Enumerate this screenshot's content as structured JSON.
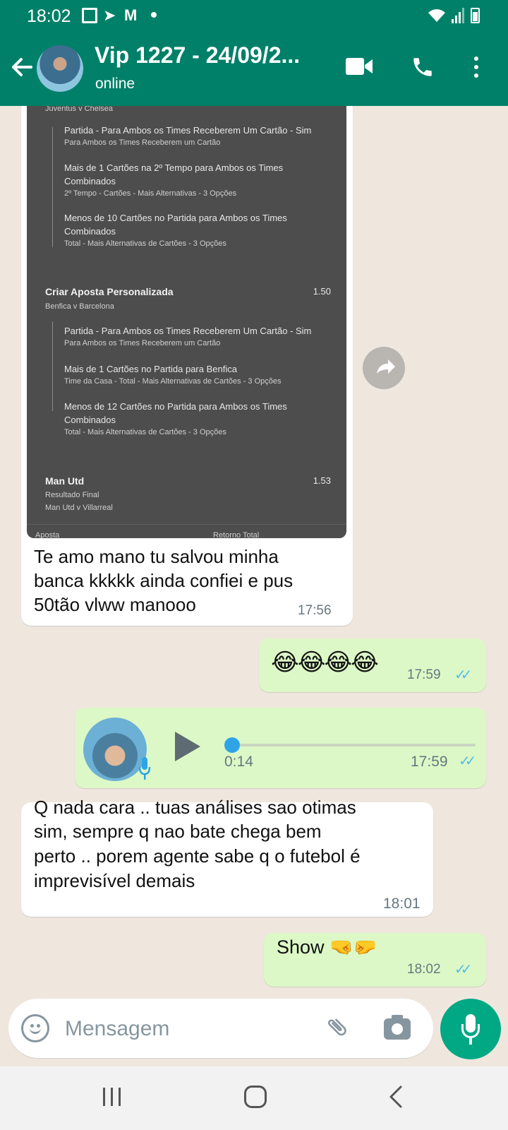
{
  "status_bar": {
    "time": "18:02",
    "icons": [
      "gallery-icon",
      "telegram-icon",
      "gmail-icon",
      "dot-icon",
      "wifi-icon",
      "signal-icon",
      "battery-icon"
    ]
  },
  "header": {
    "contact_name": "Vip 1227 - 24/09/2...",
    "contact_status": "online",
    "icons": [
      "back-arrow-icon",
      "video-call-icon",
      "voice-call-icon",
      "more-options-icon"
    ]
  },
  "colors": {
    "header_bg": "#008069",
    "chat_bg": "#efe7de",
    "incoming_bubble": "#ffffff",
    "outgoing_bubble": "#dcf8c6",
    "read_ticks": "#53bdeb",
    "mic_button": "#00a884"
  },
  "image_message": {
    "partial_top_text": "Juventus v Chelsea",
    "bet1": {
      "legs": [
        {
          "title": "Partida - Para Ambos os Times Receberem Um Cartão - Sim",
          "sub": "Para Ambos os Times Receberem um Cartão"
        },
        {
          "title": "Mais de 1 Cartões na 2º Tempo para Ambos os Times",
          "title2": "Combinados",
          "sub": "2º Tempo - Cartões - Mais Alternativas - 3 Opções"
        },
        {
          "title": "Menos de 10 Cartões no Partida para Ambos os Times",
          "title2": "Combinados",
          "sub": "Total - Mais Alternativas de Cartões - 3 Opções"
        }
      ]
    },
    "bet2": {
      "title": "Criar Aposta Personalizada",
      "odds": "1.50",
      "match": "Benfica v Barcelona",
      "legs": [
        {
          "title": "Partida - Para Ambos os Times Receberem Um Cartão - Sim",
          "sub": "Para Ambos os Times Receberem um Cartão"
        },
        {
          "title": "Mais de 1 Cartões no Partida para Benfica",
          "sub": "Time da Casa - Total - Mais Alternativas de Cartões - 3 Opções"
        },
        {
          "title": "Menos de 12 Cartões no Partida para Ambos os Times",
          "title2": "Combinados",
          "sub": "Total - Mais Alternativas de Cartões - 3 Opções"
        }
      ]
    },
    "bet3": {
      "title": "Man Utd",
      "odds": "1.53",
      "market": "Resultado Final",
      "match": "Man Utd v Villarreal"
    },
    "footer_left": "Aposta",
    "footer_right": "Retorno Total",
    "caption_line1": "Te amo mano tu salvou minha",
    "caption_line2": "banca kkkkk ainda confiei  e pus",
    "caption_line3": "50tão vlww manooo",
    "time": "17:56"
  },
  "messages": [
    {
      "direction": "out",
      "text": "😂😂😂😂",
      "time": "17:59",
      "ticks": "✓✓"
    },
    {
      "direction": "out",
      "type": "voice",
      "duration": "0:14",
      "time": "17:59",
      "ticks": "✓✓"
    },
    {
      "direction": "in",
      "lines": [
        "Q nada cara .. tuas análises  sao otimas",
        "sim, sempre  q nao bate chega  bem",
        "perto .. porem agente  sabe q o futebol é",
        "imprevisível demais"
      ],
      "time": "18:01"
    },
    {
      "direction": "out",
      "text": "Show 🤜🤛",
      "time": "18:02",
      "ticks": "✓✓"
    }
  ],
  "composer": {
    "placeholder": "Mensagem",
    "icons": [
      "emoji-icon",
      "attach-icon",
      "camera-icon",
      "mic-icon"
    ]
  },
  "nav_bar": {
    "icons": [
      "recent-apps-icon",
      "home-icon",
      "back-icon"
    ]
  }
}
